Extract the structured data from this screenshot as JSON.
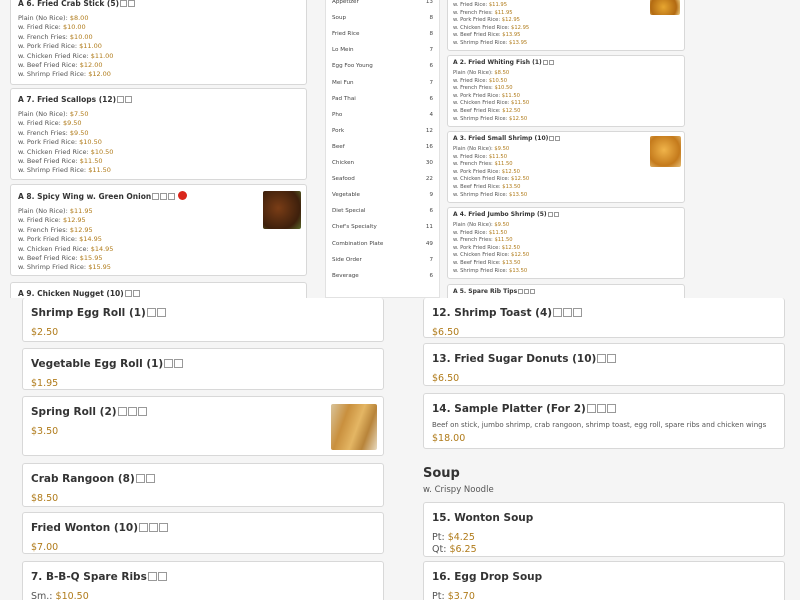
{
  "top_left": {
    "cards": [
      {
        "title": "A 6. Fried Crab Stick (5)",
        "prices": [
          [
            "Plain (No Rice): ",
            "$8.00"
          ],
          [
            "w. Fried Rice: ",
            "$10.00"
          ],
          [
            "w. French Fries: ",
            "$10.00"
          ],
          [
            "w. Pork Fried Rice: ",
            "$11.00"
          ],
          [
            "w. Chicken Fried Rice: ",
            "$11.00"
          ],
          [
            "w. Beef Fried Rice: ",
            "$12.00"
          ],
          [
            "w. Shrimp Fried Rice: ",
            "$12.00"
          ]
        ]
      },
      {
        "title": "A 7. Fried Scallops (12)",
        "prices": [
          [
            "Plain (No Rice): ",
            "$7.50"
          ],
          [
            "w. Fried Rice: ",
            "$9.50"
          ],
          [
            "w. French Fries: ",
            "$9.50"
          ],
          [
            "w. Pork Fried Rice: ",
            "$10.50"
          ],
          [
            "w. Chicken Fried Rice: ",
            "$10.50"
          ],
          [
            "w. Beef Fried Rice: ",
            "$11.50"
          ],
          [
            "w. Shrimp Fried Rice: ",
            "$11.50"
          ]
        ]
      },
      {
        "title": "A 8. Spicy Wing w. Green Onion",
        "prices": [
          [
            "Plain (No Rice): ",
            "$11.95"
          ],
          [
            "w. Fried Rice: ",
            "$12.95"
          ],
          [
            "w. French Fries: ",
            "$12.95"
          ],
          [
            "w. Pork Fried Rice: ",
            "$14.95"
          ],
          [
            "w. Chicken Fried Rice: ",
            "$14.95"
          ],
          [
            "w. Beef Fried Rice: ",
            "$15.95"
          ],
          [
            "w. Shrimp Fried Rice: ",
            "$15.95"
          ]
        ]
      },
      {
        "title": "A 9. Chicken Nugget (10)",
        "prices": []
      }
    ]
  },
  "categories": [
    {
      "name": "Appetizer",
      "count": "13"
    },
    {
      "name": "Soup",
      "count": "8"
    },
    {
      "name": "Fried Rice",
      "count": "8"
    },
    {
      "name": "Lo Mein",
      "count": "7"
    },
    {
      "name": "Egg Foo Young",
      "count": "6"
    },
    {
      "name": "Mei Fun",
      "count": "7"
    },
    {
      "name": "Pad Thai",
      "count": "6"
    },
    {
      "name": "Pho",
      "count": "4"
    },
    {
      "name": "Pork",
      "count": "12"
    },
    {
      "name": "Beef",
      "count": "16"
    },
    {
      "name": "Chicken",
      "count": "30"
    },
    {
      "name": "Seafood",
      "count": "22"
    },
    {
      "name": "Vegetable",
      "count": "9"
    },
    {
      "name": "Diet Special",
      "count": "6"
    },
    {
      "name": "Chef's Specialty",
      "count": "11"
    },
    {
      "name": "Combination Plate",
      "count": "49"
    },
    {
      "name": "Side Order",
      "count": "7"
    },
    {
      "name": "Beverage",
      "count": "6"
    }
  ],
  "top_right": {
    "cards": [
      {
        "title": "",
        "prices": [
          [
            "w. Fried Rice: ",
            "$11.95"
          ],
          [
            "w. French Fries: ",
            "$11.95"
          ],
          [
            "w. Pork Fried Rice: ",
            "$12.95"
          ],
          [
            "w. Chicken Fried Rice: ",
            "$12.95"
          ],
          [
            "w. Beef Fried Rice: ",
            "$13.95"
          ],
          [
            "w. Shrimp Fried Rice: ",
            "$13.95"
          ]
        ]
      },
      {
        "title": "A 2. Fried Whiting Fish (1)",
        "prices": [
          [
            "Plain (No Rice): ",
            "$8.50"
          ],
          [
            "w. Fried Rice: ",
            "$10.50"
          ],
          [
            "w. French Fries: ",
            "$10.50"
          ],
          [
            "w. Pork Fried Rice: ",
            "$11.50"
          ],
          [
            "w. Chicken Fried Rice: ",
            "$11.50"
          ],
          [
            "w. Beef Fried Rice: ",
            "$12.50"
          ],
          [
            "w. Shrimp Fried Rice: ",
            "$12.50"
          ]
        ]
      },
      {
        "title": "A 3. Fried Small Shrimp (10)",
        "prices": [
          [
            "Plain (No Rice): ",
            "$9.50"
          ],
          [
            "w. Fried Rice: ",
            "$11.50"
          ],
          [
            "w. French Fries: ",
            "$11.50"
          ],
          [
            "w. Pork Fried Rice: ",
            "$12.50"
          ],
          [
            "w. Chicken Fried Rice: ",
            "$12.50"
          ],
          [
            "w. Beef Fried Rice: ",
            "$13.50"
          ],
          [
            "w. Shrimp Fried Rice: ",
            "$13.50"
          ]
        ]
      },
      {
        "title": "A 4. Fried Jumbo Shrimp (5)",
        "prices": [
          [
            "Plain (No Rice): ",
            "$9.50"
          ],
          [
            "w. Fried Rice: ",
            "$11.50"
          ],
          [
            "w. French Fries: ",
            "$11.50"
          ],
          [
            "w. Pork Fried Rice: ",
            "$12.50"
          ],
          [
            "w. Chicken Fried Rice: ",
            "$12.50"
          ],
          [
            "w. Beef Fried Rice: ",
            "$13.50"
          ],
          [
            "w. Shrimp Fried Rice: ",
            "$13.50"
          ]
        ]
      },
      {
        "title": "A 5. Spare Rib Tips",
        "prices": []
      }
    ]
  },
  "bottom_left": {
    "cards": [
      {
        "title": "Shrimp Egg Roll (1)",
        "prices": [
          [
            "",
            "$2.50"
          ]
        ]
      },
      {
        "title": "Vegetable Egg Roll (1)",
        "prices": [
          [
            "",
            "$1.95"
          ]
        ]
      },
      {
        "title": "Spring Roll (2)",
        "prices": [
          [
            "",
            "$3.50"
          ]
        ]
      },
      {
        "title": "Crab Rangoon (8)",
        "prices": [
          [
            "",
            "$8.50"
          ]
        ]
      },
      {
        "title": "Fried Wonton (10)",
        "prices": [
          [
            "",
            "$7.00"
          ]
        ]
      },
      {
        "title": "7. B-B-Q Spare Ribs",
        "prices": [
          [
            "Sm.: ",
            "$10.50"
          ]
        ]
      }
    ]
  },
  "bottom_right": {
    "cards": [
      {
        "title": "12. Shrimp Toast (4)",
        "desc": "",
        "prices": [
          [
            "",
            "$6.50"
          ]
        ]
      },
      {
        "title": "13. Fried Sugar Donuts (10)",
        "desc": "",
        "prices": [
          [
            "",
            "$6.50"
          ]
        ]
      },
      {
        "title": "14. Sample Platter (For 2)",
        "desc": "Beef on stick, jumbo shrimp, crab rangoon, shrimp toast, egg roll, spare ribs and chicken wings",
        "prices": [
          [
            "",
            "$18.00"
          ]
        ]
      },
      {
        "title": "15. Wonton Soup",
        "desc": "",
        "prices": [
          [
            "Pt: ",
            "$4.25"
          ],
          [
            "Qt: ",
            "$6.25"
          ]
        ]
      },
      {
        "title": "16. Egg Drop Soup",
        "desc": "",
        "prices": [
          [
            "Pt: ",
            "$3.70"
          ]
        ]
      }
    ],
    "section": {
      "title": "Soup",
      "subtitle": "w. Crispy Noodle"
    }
  },
  "colors": {
    "price": "#b07b1a",
    "chili": "#d9261c"
  }
}
